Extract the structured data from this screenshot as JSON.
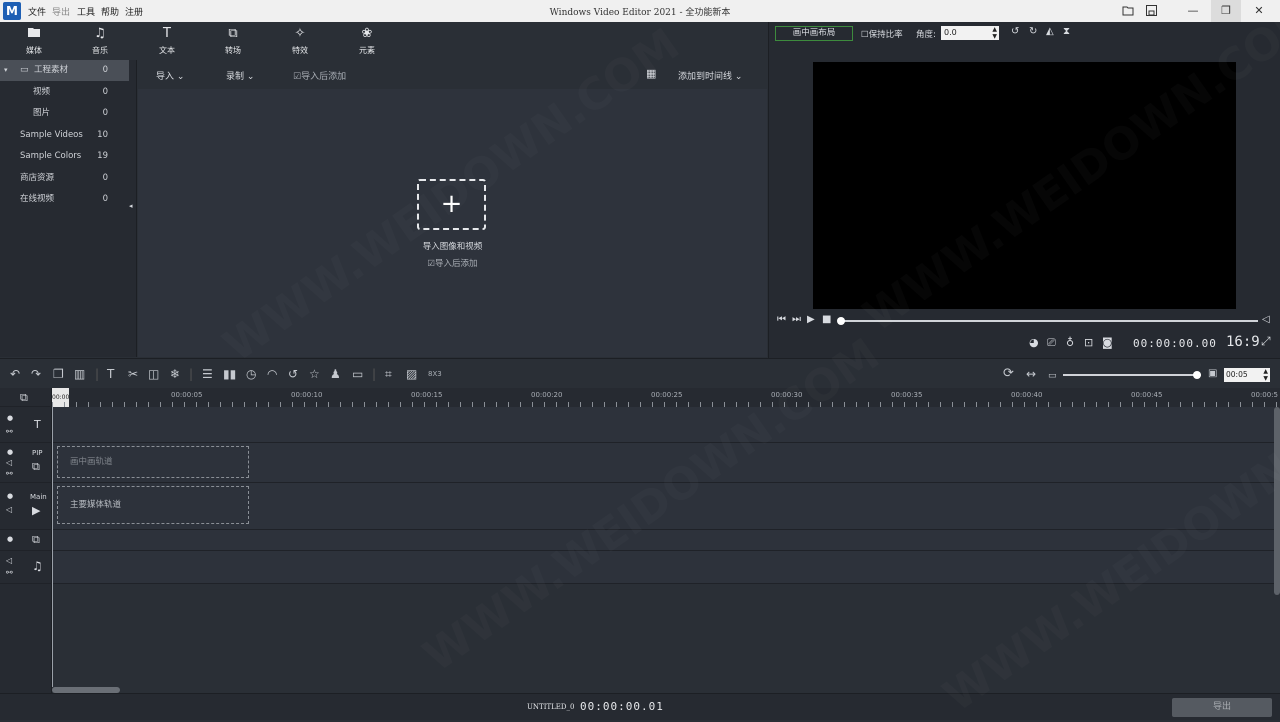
{
  "app": {
    "logo": "M",
    "title": "Windows Video Editor 2021  - 全功能新本",
    "menu": [
      "文件",
      "导出",
      "工具",
      "帮助",
      "注册"
    ]
  },
  "toolbar": {
    "tools": [
      {
        "icon": "folder-icon",
        "glyph": "▬",
        "label": "媒体"
      },
      {
        "icon": "music-note-icon",
        "glyph": "♫",
        "label": "音乐"
      },
      {
        "icon": "text-icon",
        "glyph": "T",
        "label": "文本"
      },
      {
        "icon": "transition-icon",
        "glyph": "⧉",
        "label": "转场"
      },
      {
        "icon": "effects-icon",
        "glyph": "✧",
        "label": "特效"
      },
      {
        "icon": "elements-icon",
        "glyph": "❀",
        "label": "元素"
      }
    ]
  },
  "media_tree": [
    {
      "label": "工程素材",
      "count": "0"
    },
    {
      "label": "视频",
      "count": "0"
    },
    {
      "label": "图片",
      "count": "0"
    },
    {
      "label": "Sample Videos",
      "count": "10"
    },
    {
      "label": "Sample Colors",
      "count": "19"
    },
    {
      "label": "商店资源",
      "count": "0"
    },
    {
      "label": "在线视频",
      "count": "0"
    }
  ],
  "subbar": {
    "import": "导入",
    "record": "录制",
    "add_after_import": "导入后添加",
    "add_to_timeline": "添加到时间线"
  },
  "media_area": {
    "add_label": "导入图像和视频",
    "add_after_import": "导入后添加"
  },
  "preview": {
    "layout_button": "画中画布局",
    "keep_ratio": "保持比率",
    "angle_label": "角度:",
    "angle_value": "0.0",
    "timecode": "00:00:00.00",
    "aspect": "16:9"
  },
  "timeline": {
    "speed_label": "8X3",
    "zoom_value": "00:05",
    "ruler": [
      "00:00",
      "00:00:05",
      "00:00:10",
      "00:00:15",
      "00:00:20",
      "00:00:25",
      "00:00:30",
      "00:00:35",
      "00:00:40",
      "00:00:45",
      "00:00:5"
    ],
    "tracks": {
      "pip_label": "PIP",
      "main_label": "Main",
      "pip_placeholder": "画中画轨道",
      "main_placeholder": "主要媒体轨道"
    }
  },
  "bottom": {
    "project_name": "UNTITLED_0",
    "timecode": "00:00:00.01",
    "export": "导出"
  },
  "watermark": "WWW.WEIDOWN.COM"
}
